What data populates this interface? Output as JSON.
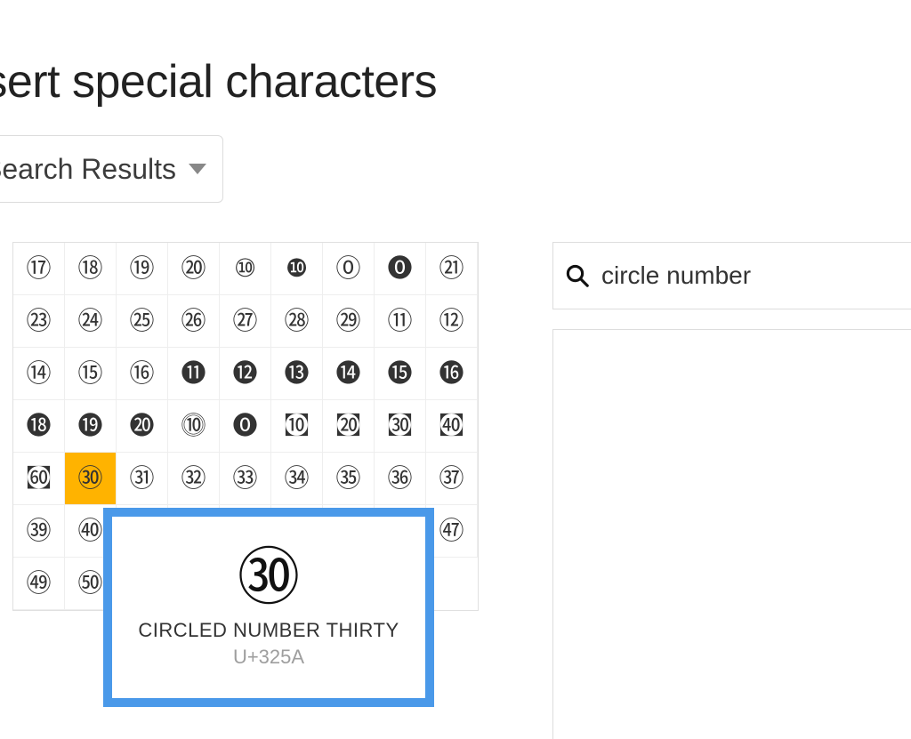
{
  "dialog": {
    "title": "Insert special characters",
    "dropdown_label": "Search Results"
  },
  "search": {
    "value": "circle number"
  },
  "grid": {
    "rows": [
      [
        {
          "glyph": "⑰"
        },
        {
          "glyph": "⑱"
        },
        {
          "glyph": "⑲"
        },
        {
          "glyph": "⑳"
        },
        {
          "glyph": "⑩"
        },
        {
          "glyph": "❿"
        },
        {
          "glyph": "🄋"
        },
        {
          "glyph": "🄌"
        },
        {
          "glyph": "㉑"
        }
      ],
      [
        {
          "glyph": "㉓"
        },
        {
          "glyph": "㉔"
        },
        {
          "glyph": "㉕"
        },
        {
          "glyph": "㉖"
        },
        {
          "glyph": "㉗"
        },
        {
          "glyph": "㉘"
        },
        {
          "glyph": "㉙"
        },
        {
          "glyph": "⑪"
        },
        {
          "glyph": "⑫"
        }
      ],
      [
        {
          "glyph": "⑭"
        },
        {
          "glyph": "⑮"
        },
        {
          "glyph": "⑯"
        },
        {
          "glyph": "⓫"
        },
        {
          "glyph": "⓬"
        },
        {
          "glyph": "⓭"
        },
        {
          "glyph": "⓮"
        },
        {
          "glyph": "⓯"
        },
        {
          "glyph": "⓰"
        }
      ],
      [
        {
          "glyph": "⓲"
        },
        {
          "glyph": "⓳"
        },
        {
          "glyph": "⓴"
        },
        {
          "glyph": "⓾"
        },
        {
          "glyph": "⓿"
        },
        {
          "glyph": "㉈"
        },
        {
          "glyph": "㉉"
        },
        {
          "glyph": "㉊"
        },
        {
          "glyph": "㉋"
        }
      ],
      [
        {
          "glyph": "㉍"
        },
        {
          "glyph": "㉚",
          "selected": true
        },
        {
          "glyph": "㉛"
        },
        {
          "glyph": "㉜"
        },
        {
          "glyph": "㉝"
        },
        {
          "glyph": "㉞"
        },
        {
          "glyph": "㉟"
        },
        {
          "glyph": "㊱"
        },
        {
          "glyph": "㊲"
        }
      ],
      [
        {
          "glyph": "㊴"
        },
        {
          "glyph": "㊵"
        },
        {
          "glyph": ""
        },
        {
          "glyph": ""
        },
        {
          "glyph": ""
        },
        {
          "glyph": ""
        },
        {
          "glyph": ""
        },
        {
          "glyph": ""
        },
        {
          "glyph": "㊼"
        }
      ],
      [
        {
          "glyph": "㊾"
        },
        {
          "glyph": "㊿"
        }
      ]
    ]
  },
  "preview": {
    "glyph": "㉚",
    "name": "CIRCLED NUMBER THIRTY",
    "code": "U+325A"
  }
}
